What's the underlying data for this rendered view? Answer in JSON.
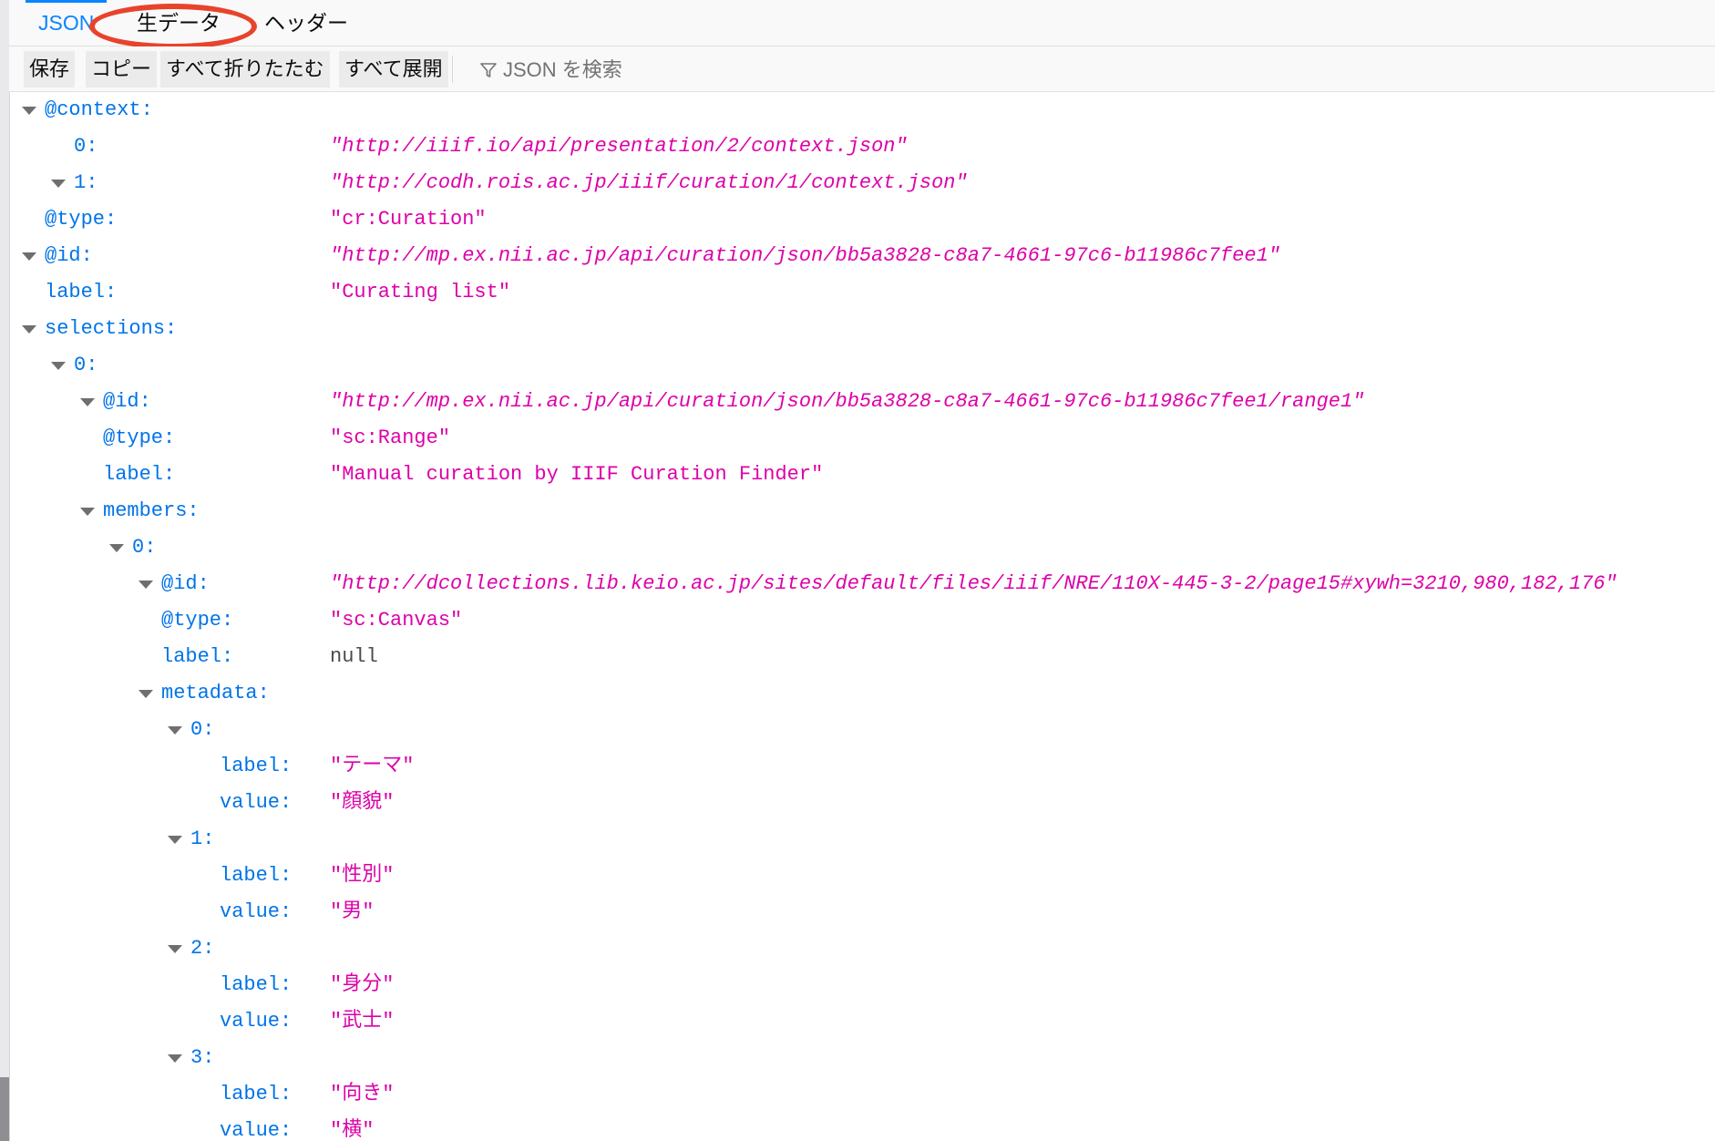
{
  "tabs": {
    "json": "JSON",
    "raw": "生データ",
    "headers": "ヘッダー"
  },
  "toolbar": {
    "save": "保存",
    "copy": "コピー",
    "collapse_all": "すべて折りたたむ",
    "expand_all": "すべて展開",
    "filter_placeholder": "JSON を検索"
  },
  "annotation": {
    "color": "#e8432b",
    "target": "raw-tab"
  },
  "colors": {
    "key": "#0074e8",
    "string": "#dd00a9",
    "null": "#4a4a4f",
    "accent": "#0a84ff"
  },
  "rows": [
    {
      "key": "@context:",
      "value": "",
      "kind": "",
      "twisty": true
    },
    {
      "key": "0:",
      "value": "\"http://iiif.io/api/presentation/2/context.json\"",
      "kind": "url",
      "twisty": false
    },
    {
      "key": "1:",
      "value": "\"http://codh.rois.ac.jp/iiif/curation/1/context.json\"",
      "kind": "url",
      "twisty": true
    },
    {
      "key": "@type:",
      "value": "\"cr:Curation\"",
      "kind": "string",
      "twisty": false
    },
    {
      "key": "@id:",
      "value": "\"http://mp.ex.nii.ac.jp/api/curation/json/bb5a3828-c8a7-4661-97c6-b11986c7fee1\"",
      "kind": "url",
      "twisty": true
    },
    {
      "key": "label:",
      "value": "\"Curating list\"",
      "kind": "string",
      "twisty": false
    },
    {
      "key": "selections:",
      "value": "",
      "kind": "",
      "twisty": true
    },
    {
      "key": "0:",
      "value": "",
      "kind": "",
      "twisty": true
    },
    {
      "key": "@id:",
      "value": "\"http://mp.ex.nii.ac.jp/api/curation/json/bb5a3828-c8a7-4661-97c6-b11986c7fee1/range1\"",
      "kind": "url",
      "twisty": true
    },
    {
      "key": "@type:",
      "value": "\"sc:Range\"",
      "kind": "string",
      "twisty": false
    },
    {
      "key": "label:",
      "value": "\"Manual curation by IIIF Curation Finder\"",
      "kind": "string",
      "twisty": false
    },
    {
      "key": "members:",
      "value": "",
      "kind": "",
      "twisty": true
    },
    {
      "key": "0:",
      "value": "",
      "kind": "",
      "twisty": true
    },
    {
      "key": "@id:",
      "value": "\"http://dcollections.lib.keio.ac.jp/sites/default/files/iiif/NRE/110X-445-3-2/page15#xywh=3210,980,182,176\"",
      "kind": "url",
      "twisty": true
    },
    {
      "key": "@type:",
      "value": "\"sc:Canvas\"",
      "kind": "string",
      "twisty": false
    },
    {
      "key": "label:",
      "value": "null",
      "kind": "null",
      "twisty": false
    },
    {
      "key": "metadata:",
      "value": "",
      "kind": "",
      "twisty": true
    },
    {
      "key": "0:",
      "value": "",
      "kind": "",
      "twisty": true
    },
    {
      "key": "label:",
      "value": "\"テーマ\"",
      "kind": "string",
      "twisty": false
    },
    {
      "key": "value:",
      "value": "\"顔貌\"",
      "kind": "string",
      "twisty": false
    },
    {
      "key": "1:",
      "value": "",
      "kind": "",
      "twisty": true
    },
    {
      "key": "label:",
      "value": "\"性別\"",
      "kind": "string",
      "twisty": false
    },
    {
      "key": "value:",
      "value": "\"男\"",
      "kind": "string",
      "twisty": false
    },
    {
      "key": "2:",
      "value": "",
      "kind": "",
      "twisty": true
    },
    {
      "key": "label:",
      "value": "\"身分\"",
      "kind": "string",
      "twisty": false
    },
    {
      "key": "value:",
      "value": "\"武士\"",
      "kind": "string",
      "twisty": false
    },
    {
      "key": "3:",
      "value": "",
      "kind": "",
      "twisty": true
    },
    {
      "key": "label:",
      "value": "\"向き\"",
      "kind": "string",
      "twisty": false
    },
    {
      "key": "value:",
      "value": "\"横\"",
      "kind": "string",
      "twisty": false
    }
  ]
}
